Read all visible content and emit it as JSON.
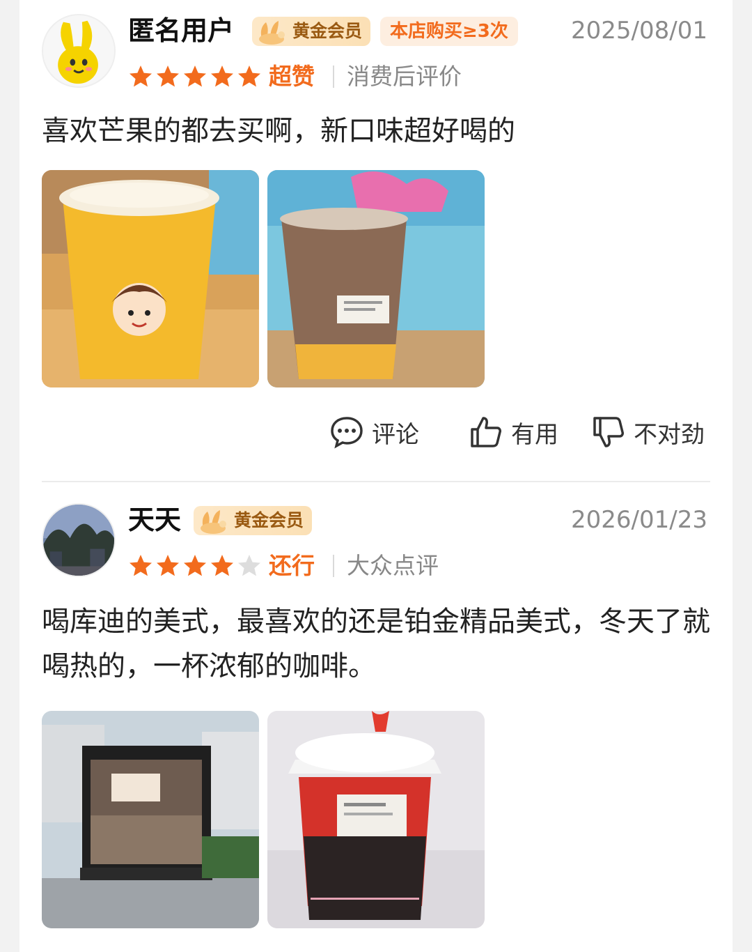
{
  "colors": {
    "accent_orange": "#f26b1d",
    "star_orange": "#f26b1d",
    "star_gray": "#dddddd",
    "gold_badge_text": "#9a5a12"
  },
  "reviews": [
    {
      "user_name": "匿名用户",
      "member_badge": "黄金会员",
      "purchase_badge": "本店购买≥3次",
      "date": "2025/08/01",
      "stars": 5,
      "rating_word": "超赞",
      "source": "消费后评价",
      "text": "喜欢芒果的都去买啊，新口味超好喝的",
      "photos": [
        "mango-drink-photo",
        "coffee-drink-photo"
      ],
      "actions": {
        "comment_label": "评论",
        "useful_label": "有用",
        "bad_label": "不对劲"
      }
    },
    {
      "user_name": "天天",
      "member_badge": "黄金会员",
      "date": "2026/01/23",
      "stars": 4,
      "rating_word": "还行",
      "source": "大众点评",
      "text": "喝库迪的美式，最喜欢的还是铂金精品美式，冬天了就喝热的，一杯浓郁的咖啡。",
      "photos": [
        "storefront-photo",
        "hot-coffee-cup-photo"
      ]
    }
  ]
}
